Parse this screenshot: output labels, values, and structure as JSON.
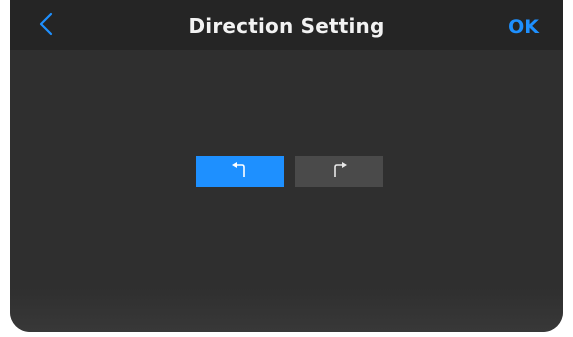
{
  "header": {
    "back_icon": "chevron-left-icon",
    "title": "Direction Setting",
    "ok_label": "OK"
  },
  "direction": {
    "options": [
      {
        "icon": "turn-left-arrow-icon",
        "selected": true
      },
      {
        "icon": "turn-right-arrow-icon",
        "selected": false
      }
    ]
  },
  "colors": {
    "accent": "#1e90ff",
    "background": "#2f2f2f",
    "header_background": "#252525",
    "unselected_button": "#4a4a4a",
    "title_text": "#f2f2f2"
  }
}
